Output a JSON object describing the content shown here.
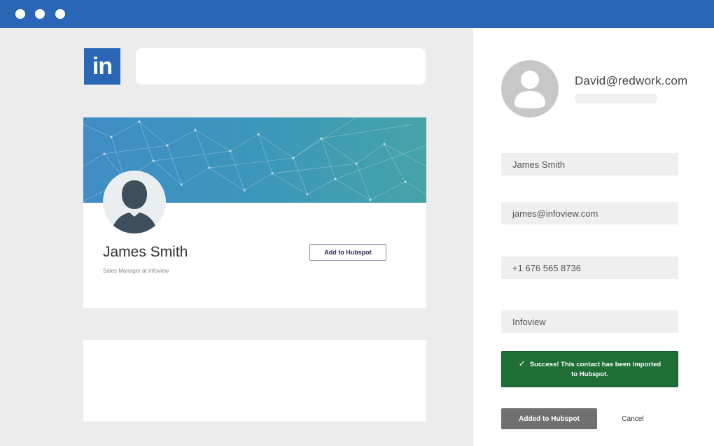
{
  "linkedin": {
    "logo_text": "in",
    "search_value": ""
  },
  "profile": {
    "name": "James Smith",
    "title": "Sales Manager at Infoview",
    "add_button_label": "Add to Hubspot"
  },
  "account": {
    "email": "David@redwork.com"
  },
  "form": {
    "name": "James Smith",
    "email": "james@infoview.com",
    "phone": "+1 676 565 8736",
    "company": "Infoview"
  },
  "alert": {
    "check": "✓",
    "message": "Success! This contact has been imported to Hubspot."
  },
  "actions": {
    "added_label": "Added to Hubspot",
    "cancel_label": "Cancel"
  },
  "colors": {
    "titlebar": "#2a66b6",
    "success": "#1e6e36",
    "added_button": "#707070"
  },
  "icons": {
    "window_controls": [
      "window-dot-icon",
      "window-dot-icon",
      "window-dot-icon"
    ],
    "avatar": "person-silhouette-icon",
    "check": "checkmark-icon"
  }
}
